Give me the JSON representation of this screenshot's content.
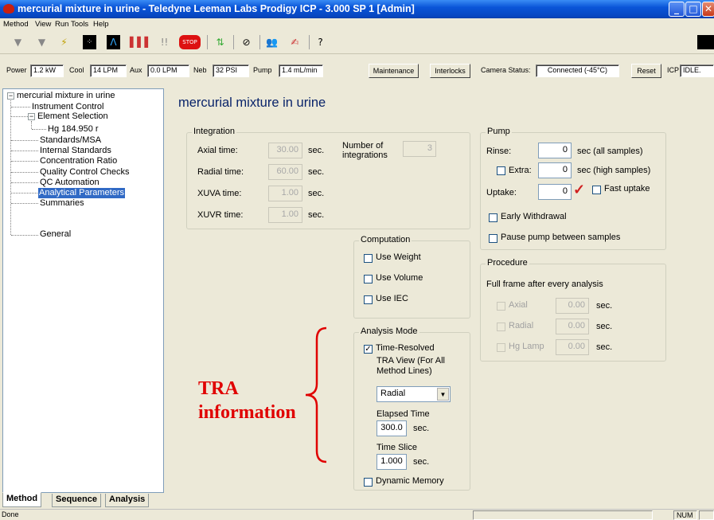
{
  "window": {
    "title": "mercurial mixture in urine - Teledyne Leeman Labs Prodigy ICP - 3.000 SP 1  [Admin]"
  },
  "menu": [
    "Method",
    "View",
    "Run",
    "Tools",
    "Help"
  ],
  "status_row": {
    "power_label": "Power",
    "power_value": "1.2 kW",
    "cool_label": "Cool",
    "cool_value": "14 LPM",
    "aux_label": "Aux",
    "aux_value": "0.0 LPM",
    "neb_label": "Neb",
    "neb_value": "32 PSI",
    "pump_label": "Pump",
    "pump_value": "1.4 mL/min",
    "maintenance_button": "Maintenance",
    "interlocks_button": "Interlocks",
    "camera_label": "Camera Status:",
    "camera_value": "Connected (-45°C)",
    "reset_button": "Reset",
    "icp_label": "ICP",
    "icp_value": "IDLE."
  },
  "tree": {
    "root": "mercurial mixture in urine",
    "instrument_control": "Instrument Control",
    "element_selection": "Element Selection",
    "hg": "Hg 184.950 r",
    "standards": "Standards/MSA",
    "internal_standards": "Internal Standards",
    "concentration_ratio": "Concentration Ratio",
    "quality_control": "Quality Control Checks",
    "qc_automation": "QC Automation",
    "analytical_parameters": "Analytical Parameters",
    "summaries": "Summaries",
    "general": "General"
  },
  "tabs": [
    "Method",
    "Sequence",
    "Analysis"
  ],
  "page_title": "mercurial mixture in urine",
  "integration": {
    "title": "Integration",
    "axial_label": "Axial time:",
    "axial_value": "30.00",
    "radial_label": "Radial time:",
    "radial_value": "60.00",
    "xuva_label": "XUVA time:",
    "xuva_value": "1.00",
    "xuvr_label": "XUVR time:",
    "xuvr_value": "1.00",
    "unit": "sec.",
    "num_label": "Number of integrations",
    "num_value": "3"
  },
  "pump": {
    "title": "Pump",
    "rinse_label": "Rinse:",
    "rinse_value": "0",
    "rinse_unit": "sec (all samples)",
    "extra_label": "Extra:",
    "extra_value": "0",
    "extra_unit": "sec (high samples)",
    "uptake_label": "Uptake:",
    "uptake_value": "0",
    "fast_uptake_label": "Fast uptake",
    "early_withdrawal_label": "Early Withdrawal",
    "pause_label": "Pause pump between samples"
  },
  "computation": {
    "title": "Computation",
    "use_weight": "Use Weight",
    "use_volume": "Use Volume",
    "use_iec": "Use IEC"
  },
  "procedure": {
    "title": "Procedure",
    "full_frame_label": "Full frame after every analysis",
    "axial_label": "Axial",
    "axial_value": "0.00",
    "radial_label": "Radial",
    "radial_value": "0.00",
    "hglamp_label": "Hg Lamp",
    "hglamp_value": "0.00",
    "unit": "sec."
  },
  "analysis_mode": {
    "title": "Analysis Mode",
    "time_resolved_label": "Time-Resolved",
    "tra_view_label": "TRA View  (For All Method Lines)",
    "tra_view_value": "Radial",
    "elapsed_label": "Elapsed Time",
    "elapsed_value": "300.0",
    "slice_label": "Time Slice",
    "slice_value": "1.000",
    "unit": "sec.",
    "dynamic_memory_label": "Dynamic Memory"
  },
  "annotation": {
    "line1": "TRA",
    "line2": "information",
    "color": "#e00000"
  },
  "statusbar": {
    "text": "Done",
    "num": "NUM"
  }
}
